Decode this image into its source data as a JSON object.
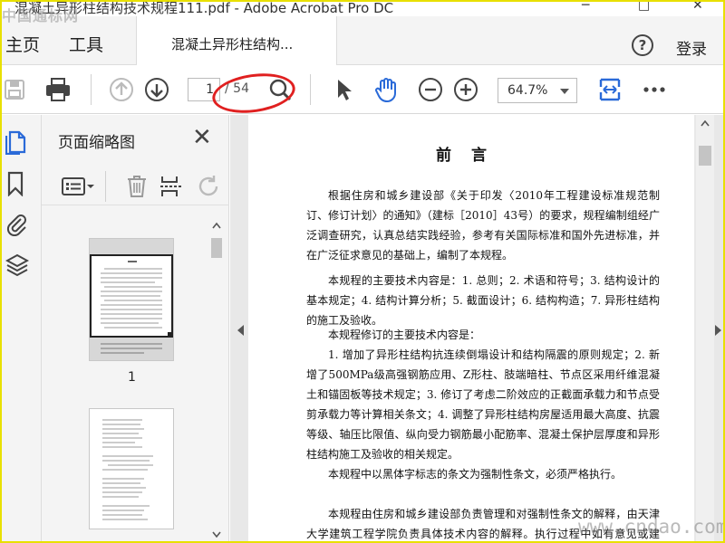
{
  "title_bar": {
    "title": "混凝土异形柱结构技术规程111.pdf - Adobe Acrobat Pro DC",
    "minimize": "─",
    "maximize": "□",
    "close": "✕"
  },
  "watermark_top": "中国通标网",
  "tabs": {
    "home": "主页",
    "tools": "工具",
    "document": "混凝土异形柱结构..."
  },
  "header": {
    "help": "?",
    "login": "登录"
  },
  "toolbar": {
    "current_page": "1",
    "total_pages": "/ 54",
    "zoom": "64.7%"
  },
  "thumbnail_panel": {
    "title": "页面缩略图",
    "close": "✕",
    "page_1_label": "1"
  },
  "document": {
    "heading": "前言",
    "paragraphs": [
      "根据住房和城乡建设部《关于印发〈2010年工程建设标准规范制订、修订计划〉的通知》（建标［2010］43号）的要求，规程编制组经广泛调查研究，认真总结实践经验，参考有关国际标准和国外先进标准，并在广泛征求意见的基础上，编制了本规程。",
      "本规程的主要技术内容是：1. 总则；2. 术语和符号；3. 结构设计的基本规定；4. 结构计算分析；5. 截面设计；6. 结构构造；7. 异形柱结构的施工及验收。",
      "本规程修订的主要技术内容是：",
      "1. 增加了异形柱结构抗连续倒塌设计和结构隔震的原则规定；2. 新增了500MPa级高强钢筋应用、Z形柱、肢端暗柱、节点区采用纤维混凝土和锚固板等技术规定；3. 修订了考虑二阶效应的正截面承载力和节点受剪承载力等计算相关条文；4. 调整了异形柱结构房屋适用最大高度、抗震等级、轴压比限值、纵向受力钢筋最小配筋率、混凝土保护层厚度和异形柱结构施工及验收的相关规定。",
      "本规程中以黑体字标志的条文为强制性条文，必须严格执行。",
      "本规程由住房和城乡建设部负责管理和对强制性条文的解释，由天津大学建筑工程学院负责具体技术内容的解释。执行过程中如有意见或建议，请寄送天津大学建筑工程学院"
    ]
  },
  "watermark_bottom": "www.cndao.com",
  "colors": {
    "accent_blue": "#2a6ad8",
    "annotation_red": "#e02020",
    "frame_yellow": "#e8e000"
  }
}
